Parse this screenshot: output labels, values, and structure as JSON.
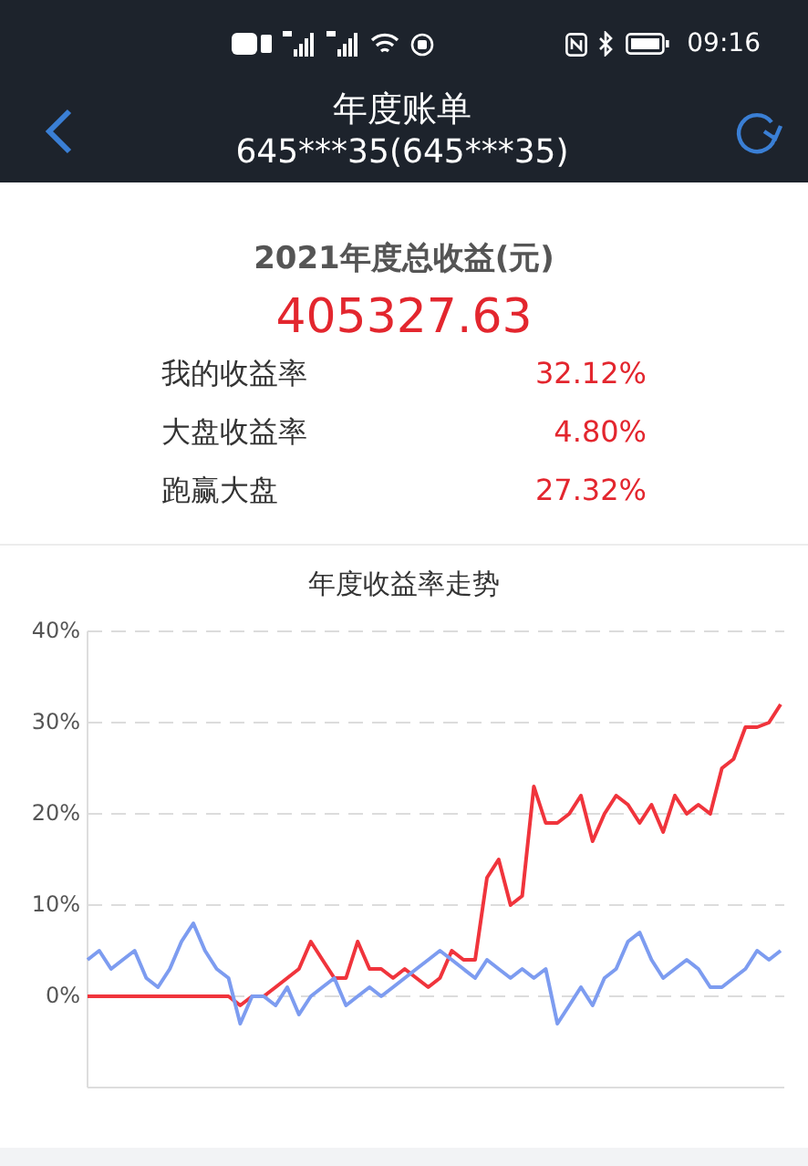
{
  "status_bar": {
    "time": "09:16"
  },
  "header": {
    "title": "年度账单",
    "subtitle": "645***35(645***35)"
  },
  "summary": {
    "title": "2021年度总收益(元)",
    "total": "405327.63",
    "rows": [
      {
        "label": "我的收益率",
        "value": "32.12%"
      },
      {
        "label": "大盘收益率",
        "value": "4.80%"
      },
      {
        "label": "跑赢大盘",
        "value": "27.32%"
      }
    ]
  },
  "trend": {
    "title": "年度收益率走势",
    "chart_data": {
      "type": "line",
      "grid": true,
      "ylim": [
        -10,
        40
      ],
      "yticks": [
        {
          "value": 0,
          "label": "0%"
        },
        {
          "value": 10,
          "label": "10%"
        },
        {
          "value": 20,
          "label": "20%"
        },
        {
          "value": 30,
          "label": "30%"
        },
        {
          "value": 40,
          "label": "40%"
        }
      ],
      "series": [
        {
          "color": "#f0343c",
          "values": [
            0,
            0,
            0,
            0,
            0,
            0,
            0,
            0,
            0,
            0,
            0,
            0,
            0,
            -1,
            0,
            0,
            1,
            2,
            3,
            6,
            4,
            2,
            2,
            6,
            3,
            3,
            2,
            3,
            2,
            1,
            2,
            5,
            4,
            4,
            13,
            15,
            10,
            11,
            23,
            19,
            19,
            20,
            22,
            17,
            20,
            22,
            21,
            19,
            21,
            18,
            22,
            20,
            21,
            20,
            25,
            26,
            29.5,
            29.5,
            30,
            32
          ]
        },
        {
          "color": "#7d9cf0",
          "values": [
            4,
            5,
            3,
            4,
            5,
            2,
            1,
            3,
            6,
            8,
            5,
            3,
            2,
            -3,
            0,
            0,
            -1,
            1,
            -2,
            0,
            1,
            2,
            -1,
            0,
            1,
            0,
            1,
            2,
            3,
            4,
            5,
            4,
            3,
            2,
            4,
            3,
            2,
            3,
            2,
            3,
            -3,
            -1,
            1,
            -1,
            2,
            3,
            6,
            7,
            4,
            2,
            3,
            4,
            3,
            1,
            1,
            2,
            3,
            5,
            4,
            5
          ]
        }
      ]
    }
  }
}
